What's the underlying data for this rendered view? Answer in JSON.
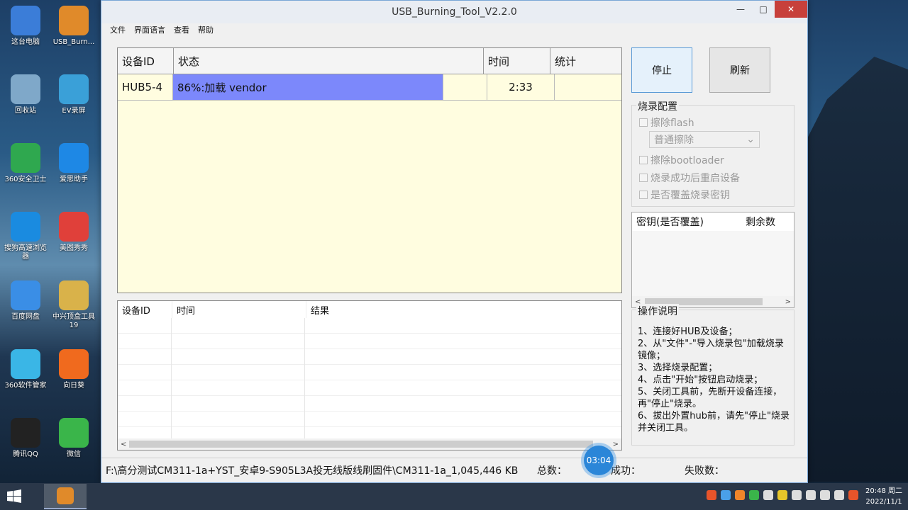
{
  "window": {
    "title": "USB_Burning_Tool_V2.2.0",
    "minimize_icon": "minimize-icon",
    "maximize_icon": "maximize-icon",
    "close_icon": "close-icon"
  },
  "menu": {
    "file": "文件",
    "language": "界面语言",
    "view": "查看",
    "help": "帮助"
  },
  "device_table": {
    "headers": {
      "id": "设备ID",
      "status": "状态",
      "time": "时间",
      "stats": "统计"
    },
    "rows": [
      {
        "id": "HUB5-4",
        "status": "86%:加载 vendor",
        "progress": 86,
        "time": "2:33",
        "stats": ""
      }
    ],
    "progress_color": "#7c88fb",
    "background_color": "#fffde0"
  },
  "log_table": {
    "headers": {
      "id": "设备ID",
      "time": "时间",
      "result": "结果"
    },
    "scroll_left": "<",
    "scroll_right": ">"
  },
  "buttons": {
    "stop": "停止",
    "refresh": "刷新"
  },
  "burn_config": {
    "title": "烧录配置",
    "erase_flash": "擦除flash",
    "erase_mode": "普通擦除",
    "erase_bootloader": "擦除bootloader",
    "reboot_after": "烧录成功后重启设备",
    "overwrite_key": "是否覆盖烧录密钥"
  },
  "key_table": {
    "headers": {
      "key": "密钥(是否覆盖)",
      "remaining": "剩余数"
    },
    "scroll_left": "<",
    "scroll_right": ">"
  },
  "instructions": {
    "title": "操作说明",
    "text": "1、连接好HUB及设备；\n2、从\"文件\"-\"导入烧录包\"加载烧录镜像；\n3、选择烧录配置；\n4、点击\"开始\"按钮启动烧录；\n5、关闭工具前，先断开设备连接，再\"停止\"烧录。\n6、拔出外置hub前，请先\"停止\"烧录并关闭工具。"
  },
  "statusbar": {
    "path": "F:\\高分测试CM311-1a+YST_安卓9-S905L3A投无线版线刷固件\\CM311-1a_1,045,446 KB",
    "total_label": "总数：",
    "success_label": "成功：",
    "fail_label": "失败数："
  },
  "timer": "03:04",
  "desktop_icons": [
    {
      "label": "这台电脑",
      "icon": "computer-icon",
      "color": "#3b7dd8"
    },
    {
      "label": "USB_Burn...",
      "icon": "usb-burn-icon",
      "color": "#e08a2a"
    },
    {
      "label": "回收站",
      "icon": "recycle-bin-icon",
      "color": "#7fa8c9"
    },
    {
      "label": "EV录屏",
      "icon": "ev-recorder-icon",
      "color": "#3aa0d8"
    },
    {
      "label": "360安全卫士",
      "icon": "360-security-icon",
      "color": "#2fa84f"
    },
    {
      "label": "爱思助手",
      "icon": "aisi-icon",
      "color": "#1e88e5"
    },
    {
      "label": "搜狗高速浏览器",
      "icon": "sogou-browser-icon",
      "color": "#1a8be0"
    },
    {
      "label": "美图秀秀",
      "icon": "meitu-icon",
      "color": "#e0403a"
    },
    {
      "label": "百度网盘",
      "icon": "baidu-netdisk-icon",
      "color": "#3a8ee6"
    },
    {
      "label": "中兴顶盒工具19",
      "icon": "folder-icon",
      "color": "#d9b24a"
    },
    {
      "label": "360软件管家",
      "icon": "360-software-icon",
      "color": "#3ab6e6"
    },
    {
      "label": "向日葵",
      "icon": "sunflower-icon",
      "color": "#f06a1e"
    },
    {
      "label": "腾讯QQ",
      "icon": "qq-icon",
      "color": "#222222"
    },
    {
      "label": "微信",
      "icon": "wechat-icon",
      "color": "#3ab54a"
    }
  ],
  "taskbar": {
    "time": "20:48 周二",
    "date": "2022/11/1",
    "start_icon": "windows-start-icon"
  }
}
